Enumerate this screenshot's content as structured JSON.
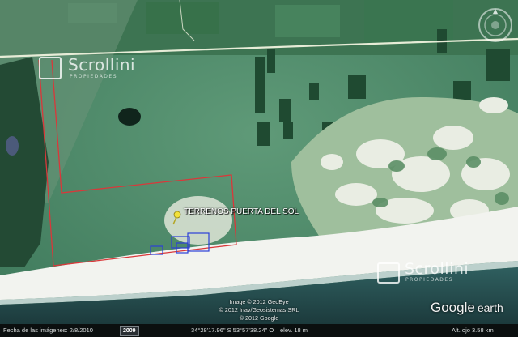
{
  "placemark": {
    "label": "TERRENOS PUERTA DEL SOL",
    "icon": "yellow-pushpin-icon"
  },
  "watermarks": [
    {
      "brand": "Scrollini",
      "tagline": "PROPIEDADES"
    },
    {
      "brand": "Scrollini",
      "tagline": "PROPIEDADES"
    }
  ],
  "credits": [
    "Image © 2012 GeoEye",
    "© 2012 Inav/Geosistemas SRL",
    "© 2012 Google"
  ],
  "brand_logo": {
    "google": "Google",
    "earth": "earth"
  },
  "status_bar": {
    "imagery_date": "Fecha de las imágenes: 2/8/2010",
    "year_badge": "2009",
    "coordinates": "34°28'17.96\" S  53°57'38.24\" O",
    "elevation": "elev.   18 m",
    "eye_altitude": "Alt. ojo   3.58 km"
  },
  "colors": {
    "boundary": "#d9383a",
    "parcels": "#2c3fd8",
    "road": "#e7ecd7",
    "pin": "#f2e13a"
  }
}
